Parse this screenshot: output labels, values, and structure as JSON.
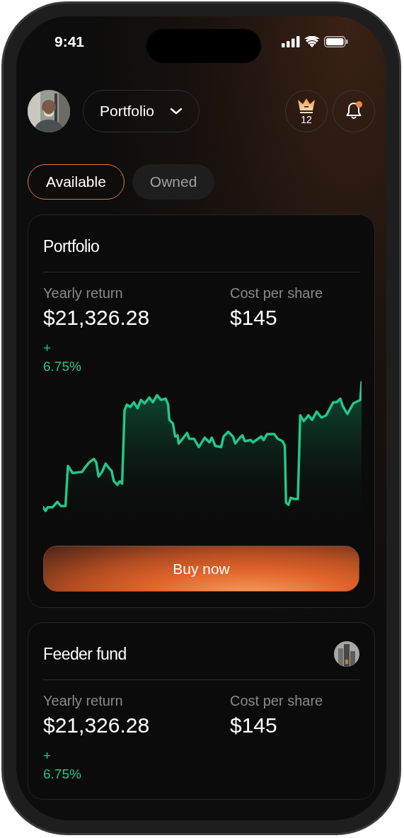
{
  "status_bar": {
    "time": "9:41"
  },
  "header": {
    "dropdown": {
      "label": "Portfolio"
    },
    "rewards": {
      "count": "12"
    },
    "notifications": {
      "unread": true
    }
  },
  "tabs": [
    {
      "label": "Available",
      "selected": true
    },
    {
      "label": "Owned",
      "selected": false
    }
  ],
  "cards": [
    {
      "title": "Portfolio",
      "stats": [
        {
          "label": "Yearly return",
          "value": "$21,326.28"
        },
        {
          "label": "Cost per share",
          "value": "$145"
        }
      ],
      "change": {
        "sign": "+",
        "value": "6.75%"
      },
      "button": "Buy now"
    },
    {
      "title": "Feeder fund",
      "stats": [
        {
          "label": "Yearly return",
          "value": "$21,326.28"
        },
        {
          "label": "Cost per share",
          "value": "$145"
        }
      ],
      "change": {
        "sign": "+",
        "value": "6.75%"
      }
    }
  ]
}
